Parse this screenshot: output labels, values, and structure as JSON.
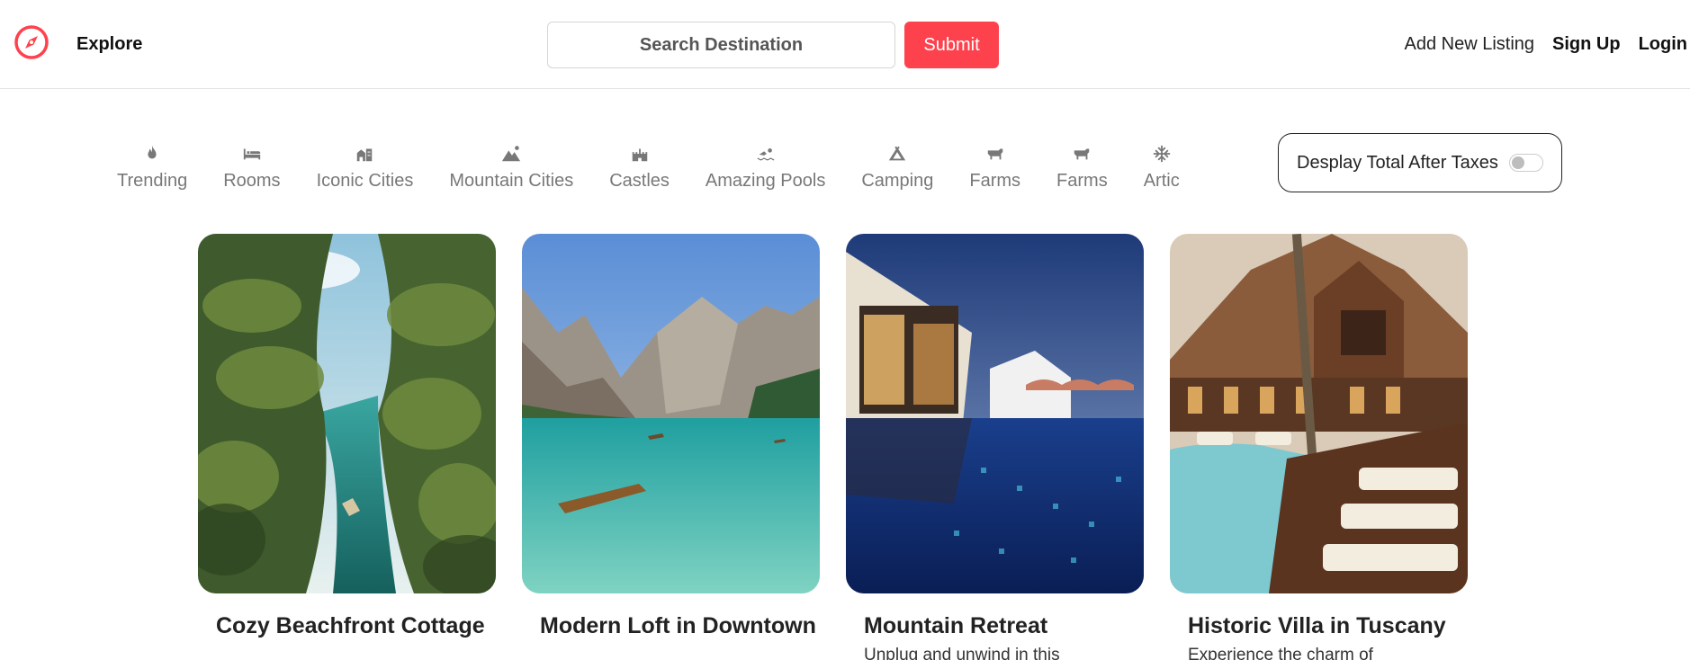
{
  "navbar": {
    "explore_label": "Explore",
    "search": {
      "placeholder": "Search Destination"
    },
    "submit_label": "Submit",
    "links": {
      "add_listing": "Add New Listing",
      "sign_up": "Sign Up",
      "login": "Login"
    },
    "brand_color": "#fe424d"
  },
  "filters": [
    {
      "label": "Trending",
      "icon": "fire-icon"
    },
    {
      "label": "Rooms",
      "icon": "bed-icon"
    },
    {
      "label": "Iconic Cities",
      "icon": "city-icon"
    },
    {
      "label": "Mountain Cities",
      "icon": "mountain-icon"
    },
    {
      "label": "Castles",
      "icon": "castle-icon"
    },
    {
      "label": "Amazing Pools",
      "icon": "swimmer-icon"
    },
    {
      "label": "Camping",
      "icon": "tent-icon"
    },
    {
      "label": "Farms",
      "icon": "cow-icon"
    },
    {
      "label": "Farms",
      "icon": "cow-icon"
    },
    {
      "label": "Artic",
      "icon": "snowflake-icon"
    }
  ],
  "tax_toggle": {
    "label": "Desplay Total After Taxes",
    "enabled": false
  },
  "listings": [
    {
      "title": "Cozy Beachfront Cottage",
      "description": ""
    },
    {
      "title": "Modern Loft in Downtown",
      "description": ""
    },
    {
      "title": "Mountain Retreat",
      "description": "Unplug and unwind in this"
    },
    {
      "title": "Historic Villa in Tuscany",
      "description": "Experience the charm of"
    }
  ]
}
